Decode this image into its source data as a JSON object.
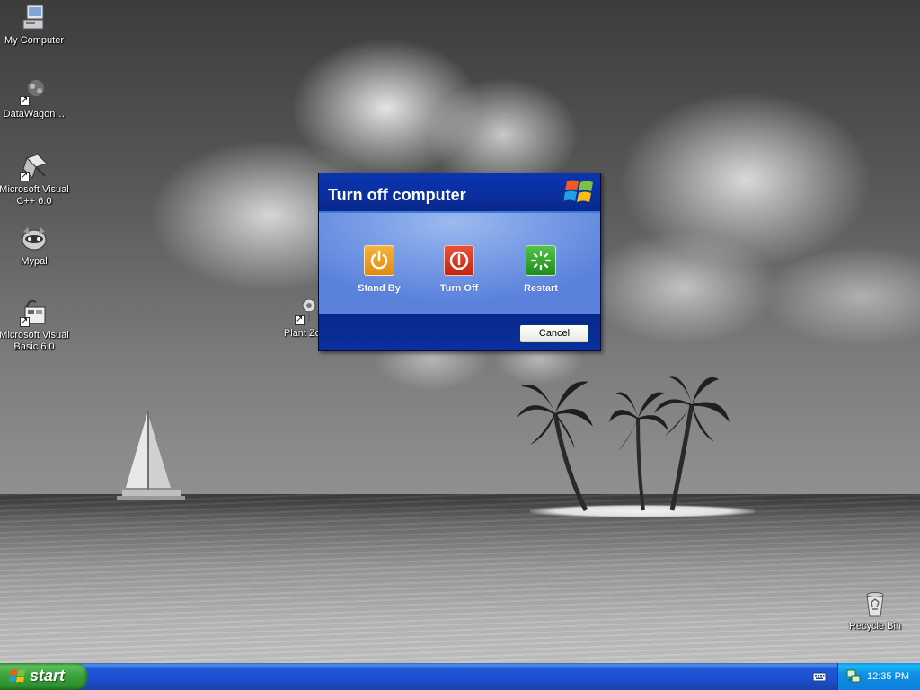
{
  "desktop": {
    "icons": [
      {
        "label": "My Computer",
        "icon": "my-computer-icon"
      },
      {
        "label": "DataWagon…",
        "icon": "datawagon-icon"
      },
      {
        "label": "Microsoft Visual C++ 6.0",
        "icon": "visual-cpp-icon"
      },
      {
        "label": "Mypal",
        "icon": "mypal-icon"
      },
      {
        "label": "Microsoft Visual Basic 6.0",
        "icon": "visual-basic-icon"
      },
      {
        "label": "Plant Zomb",
        "icon": "plants-vs-zombies-icon"
      },
      {
        "label": "Recycle Bin",
        "icon": "recycle-bin-icon"
      }
    ]
  },
  "dialog": {
    "title": "Turn off computer",
    "options": [
      {
        "label": "Stand By",
        "icon": "standby-icon",
        "color": "#e08a12"
      },
      {
        "label": "Turn Off",
        "icon": "power-icon",
        "color": "#c22410"
      },
      {
        "label": "Restart",
        "icon": "restart-icon",
        "color": "#1f8c1c"
      }
    ],
    "cancel_label": "Cancel"
  },
  "taskbar": {
    "start_label": "start",
    "clock": "12:35 PM"
  },
  "colors": {
    "dialog_header": "#0a2f9e",
    "dialog_body": "#7c9fe6",
    "taskbar": "#2157d7",
    "start_button": "#3da83d",
    "tray": "#0f8fe5"
  }
}
